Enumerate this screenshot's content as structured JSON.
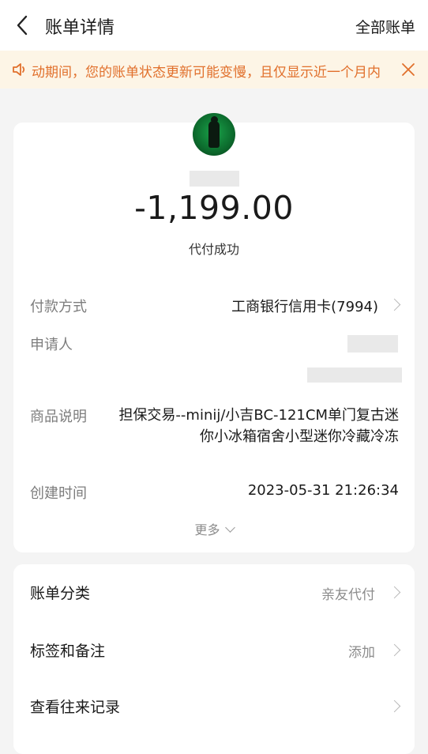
{
  "header": {
    "title": "账单详情",
    "all_bills": "全部账单"
  },
  "notice": {
    "text": "动期间，您的账单状态更新可能变慢，且仅显示近一个月内"
  },
  "transaction": {
    "amount": "-1,199.00",
    "status": "代付成功"
  },
  "details": {
    "payment_method_label": "付款方式",
    "payment_method_value": "工商银行信用卡(7994)",
    "applicant_label": "申请人",
    "product_label": "商品说明",
    "product_value": "担保交易--minij/小吉BC-121CM单门复古迷你小冰箱宿舍小型迷你冷藏冷冻",
    "created_label": "创建时间",
    "created_value": "2023-05-31 21:26:34",
    "more": "更多"
  },
  "options": [
    {
      "label": "账单分类",
      "value": "亲友代付"
    },
    {
      "label": "标签和备注",
      "value": "添加"
    },
    {
      "label": "查看往来记录",
      "value": ""
    }
  ],
  "icons": {
    "back": "back-arrow-icon",
    "speaker": "speaker-icon",
    "close": "close-icon",
    "chevron": "chevron-right-icon",
    "more": "chevron-down-icon"
  },
  "colors": {
    "notice_bg": "#fdf5e6",
    "notice_text": "#e1702c",
    "page_bg": "#f4f4f4"
  }
}
